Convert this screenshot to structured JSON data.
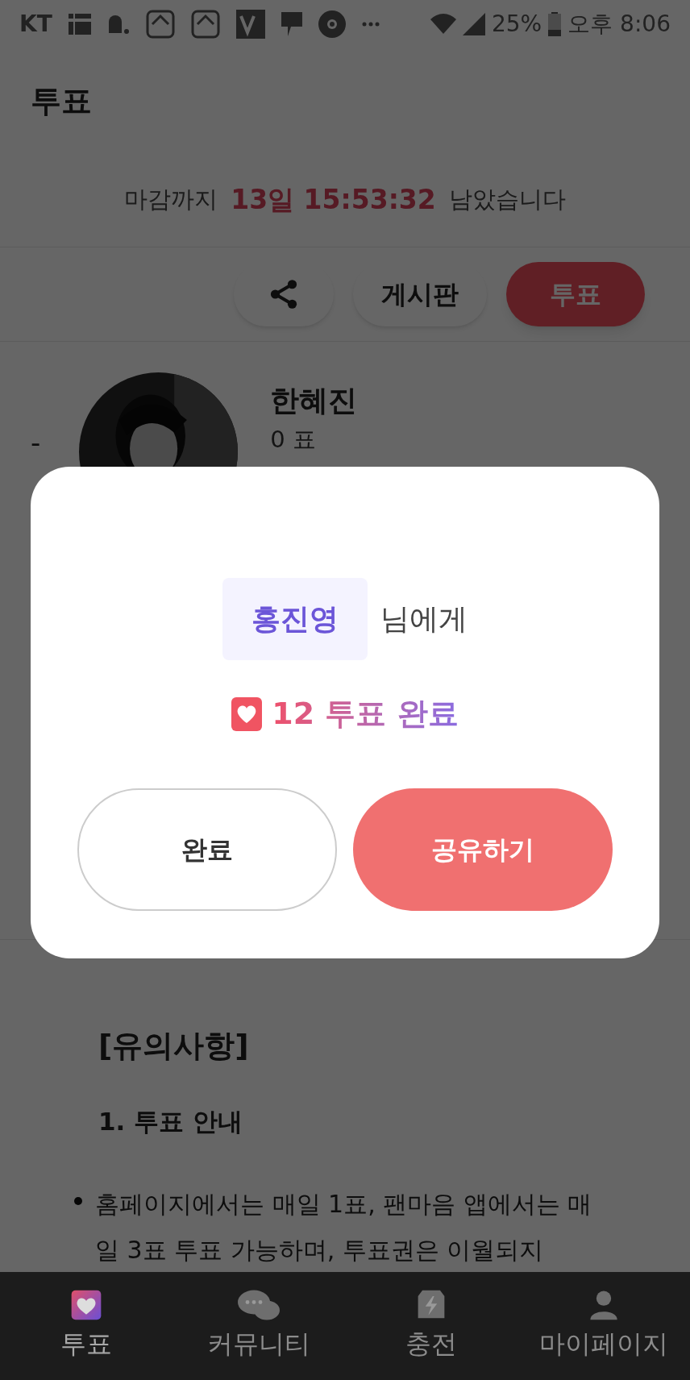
{
  "status_bar": {
    "carrier": "KT",
    "battery": "25%",
    "time": "오후 8:06"
  },
  "header": {
    "title": "투표"
  },
  "countdown": {
    "prefix": "마감까지",
    "remaining": "13일 15:53:32",
    "suffix": "남았습니다"
  },
  "actions": [
    {
      "kind": "share"
    },
    {
      "kind": "plain",
      "label": "게시판"
    },
    {
      "kind": "primary",
      "label": "투표"
    }
  ],
  "candidate": {
    "rank": "-",
    "name": "한혜진",
    "votes": "0 표"
  },
  "modal": {
    "recipient": "홍진영",
    "recipient_suffix": "님에게",
    "result": "12 투표 완료",
    "buttons": [
      {
        "kind": "outline",
        "label": "완료"
      },
      {
        "kind": "primary",
        "label": "공유하기"
      }
    ]
  },
  "notice": {
    "title": "[유의사항]",
    "section": "1. 투표 안내",
    "bullets": [
      "홈페이지에서는 매일 1표, 팬마음 앱에서는 매일 3표 투표 가능하며, 투표권은 이월되지"
    ]
  },
  "bottom_nav": [
    {
      "label": "투표",
      "selected": true
    },
    {
      "label": "커뮤니티",
      "selected": false
    },
    {
      "label": "충전",
      "selected": false
    },
    {
      "label": "마이페이지",
      "selected": false
    }
  ]
}
